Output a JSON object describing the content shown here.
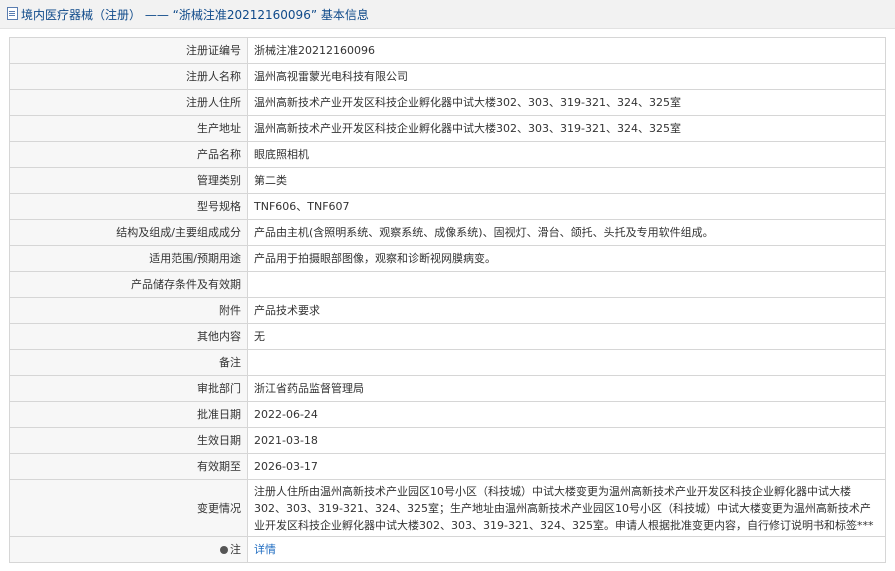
{
  "page_title": "境内医疗器械（注册） —— “浙械注准20212160096” 基本信息",
  "rows": [
    {
      "label": "注册证编号",
      "value": "浙械注准20212160096"
    },
    {
      "label": "注册人名称",
      "value": "温州高视雷蒙光电科技有限公司"
    },
    {
      "label": "注册人住所",
      "value": "温州高新技术产业开发区科技企业孵化器中试大楼302、303、319-321、324、325室"
    },
    {
      "label": "生产地址",
      "value": "温州高新技术产业开发区科技企业孵化器中试大楼302、303、319-321、324、325室"
    },
    {
      "label": "产品名称",
      "value": "眼底照相机"
    },
    {
      "label": "管理类别",
      "value": "第二类"
    },
    {
      "label": "型号规格",
      "value": "TNF606、TNF607"
    },
    {
      "label": "结构及组成/主要组成成分",
      "value": "产品由主机(含照明系统、观察系统、成像系统)、固视灯、滑台、颌托、头托及专用软件组成。"
    },
    {
      "label": "适用范围/预期用途",
      "value": "产品用于拍摄眼部图像，观察和诊断视网膜病变。"
    },
    {
      "label": "产品储存条件及有效期",
      "value": ""
    },
    {
      "label": "附件",
      "value": "产品技术要求"
    },
    {
      "label": "其他内容",
      "value": "无"
    },
    {
      "label": "备注",
      "value": ""
    },
    {
      "label": "审批部门",
      "value": "浙江省药品监督管理局"
    },
    {
      "label": "批准日期",
      "value": "2022-06-24"
    },
    {
      "label": "生效日期",
      "value": "2021-03-18"
    },
    {
      "label": "有效期至",
      "value": "2026-03-17"
    },
    {
      "label": "变更情况",
      "value": "注册人住所由温州高新技术产业园区10号小区（科技城）中试大楼变更为温州高新技术产业开发区科技企业孵化器中试大楼302、303、319-321、324、325室；生产地址由温州高新技术产业园区10号小区（科技城）中试大楼变更为温州高新技术产业开发区科技企业孵化器中试大楼302、303、319-321、324、325室。申请人根据批准变更内容，自行修订说明书和标签***"
    }
  ],
  "note": {
    "label": "注",
    "link": "详情",
    "icon": "note-icon"
  }
}
